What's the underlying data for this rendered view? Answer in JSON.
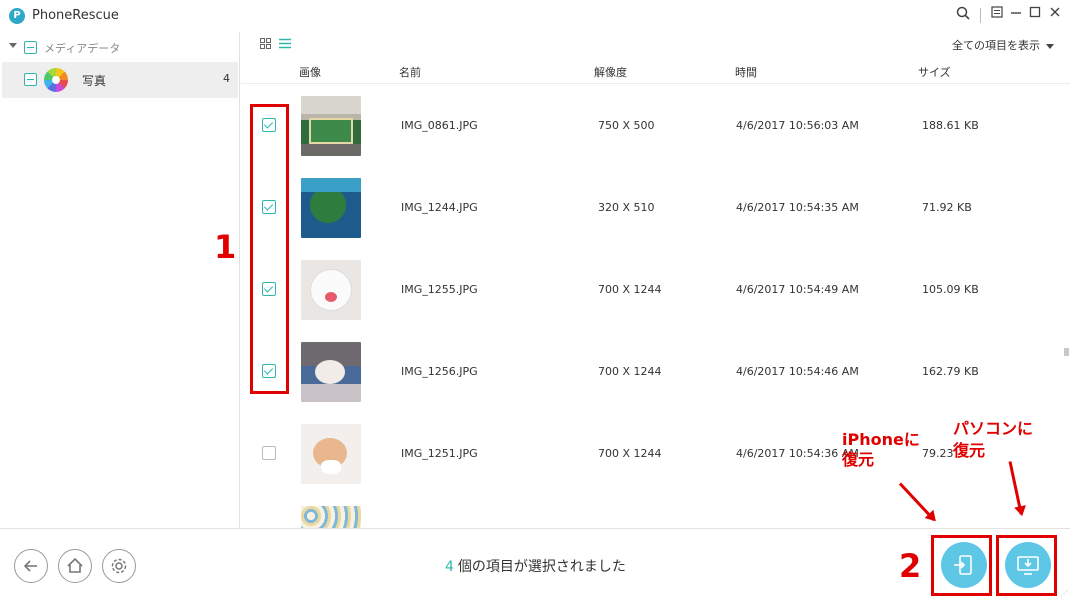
{
  "app": {
    "title": "PhoneRescue",
    "logo": "P"
  },
  "titlebar_icons": [
    "search-icon",
    "menu-icon",
    "minimize-icon",
    "maximize-icon",
    "close-icon"
  ],
  "sidebar": {
    "category": "メディアデータ",
    "photos": {
      "label": "写真",
      "count": "4"
    }
  },
  "main": {
    "filter": "全ての項目を表示",
    "columns": {
      "image": "画像",
      "name": "名前",
      "resolution": "解像度",
      "time": "時間",
      "size": "サイズ"
    },
    "rows": [
      {
        "checked": true,
        "name": "IMG_0861.JPG",
        "resolution": "750 X 500",
        "time": "4/6/2017 10:56:03 AM",
        "size": "188.61 KB"
      },
      {
        "checked": true,
        "name": "IMG_1244.JPG",
        "resolution": "320 X 510",
        "time": "4/6/2017 10:54:35 AM",
        "size": "71.92 KB"
      },
      {
        "checked": true,
        "name": "IMG_1255.JPG",
        "resolution": "700 X 1244",
        "time": "4/6/2017 10:54:49 AM",
        "size": "105.09 KB"
      },
      {
        "checked": true,
        "name": "IMG_1256.JPG",
        "resolution": "700 X 1244",
        "time": "4/6/2017 10:54:46 AM",
        "size": "162.79 KB"
      },
      {
        "checked": false,
        "name": "IMG_1251.JPG",
        "resolution": "700 X 1244",
        "time": "4/6/2017 10:54:36 AM",
        "size": "79.23"
      }
    ]
  },
  "bottom": {
    "selected_count": "4",
    "selected_text": "個の項目が選択されました"
  },
  "annotations": {
    "step1": "1",
    "step2": "2",
    "to_iphone_line1": "iPhoneに",
    "to_iphone_line2": "復元",
    "to_pc_line1": "パソコンに",
    "to_pc_line2": "復元"
  },
  "colors": {
    "accent": "#2fb8a9",
    "action": "#5fc7e6",
    "annotation": "#e00000"
  }
}
